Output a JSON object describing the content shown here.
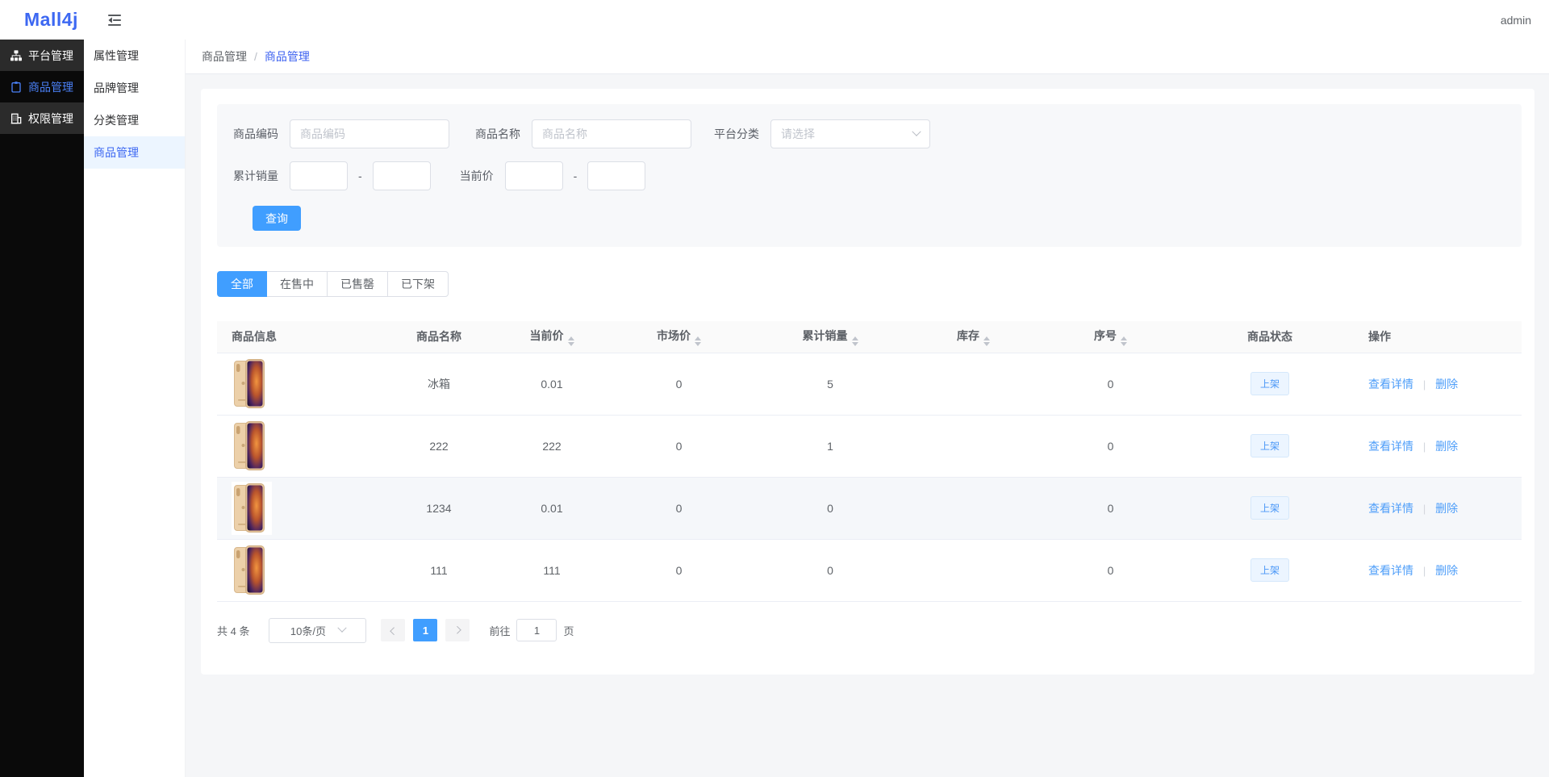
{
  "topbar": {
    "logo": "Mall4j",
    "username": "admin"
  },
  "sidebar": {
    "items": [
      {
        "label": "平台管理",
        "icon": "sitemap-icon",
        "active": false
      },
      {
        "label": "商品管理",
        "icon": "clipboard-icon",
        "active": true
      },
      {
        "label": "权限管理",
        "icon": "building-icon",
        "active": false
      }
    ]
  },
  "submenu": {
    "items": [
      {
        "label": "属性管理",
        "active": false
      },
      {
        "label": "品牌管理",
        "active": false
      },
      {
        "label": "分类管理",
        "active": false
      },
      {
        "label": "商品管理",
        "active": true
      }
    ]
  },
  "breadcrumb": {
    "parent": "商品管理",
    "separator": "/",
    "current": "商品管理"
  },
  "filters": {
    "product_code": {
      "label": "商品编码",
      "placeholder": "商品编码",
      "value": ""
    },
    "product_name": {
      "label": "商品名称",
      "placeholder": "商品名称",
      "value": ""
    },
    "platform_category": {
      "label": "平台分类",
      "placeholder": "请选择"
    },
    "total_sales": {
      "label": "累计销量",
      "min": "",
      "max": ""
    },
    "current_price": {
      "label": "当前价",
      "min": "",
      "max": ""
    },
    "range_separator": "-",
    "search_button": "查询"
  },
  "status_tabs": [
    {
      "label": "全部",
      "active": true
    },
    {
      "label": "在售中",
      "active": false
    },
    {
      "label": "已售罄",
      "active": false
    },
    {
      "label": "已下架",
      "active": false
    }
  ],
  "table": {
    "columns": [
      {
        "label": "商品信息",
        "sortable": false
      },
      {
        "label": "商品名称",
        "sortable": false
      },
      {
        "label": "当前价",
        "sortable": true
      },
      {
        "label": "市场价",
        "sortable": true
      },
      {
        "label": "累计销量",
        "sortable": true
      },
      {
        "label": "库存",
        "sortable": true
      },
      {
        "label": "序号",
        "sortable": true
      },
      {
        "label": "商品状态",
        "sortable": false
      },
      {
        "label": "操作",
        "sortable": false
      }
    ],
    "action_separator": "|",
    "rows": [
      {
        "name": "冰箱",
        "current_price": "0.01",
        "market_price": "0",
        "total_sales": "5",
        "stock": "",
        "seq": "0",
        "status": "上架",
        "view_action": "查看详情",
        "delete_action": "删除",
        "highlighted": false
      },
      {
        "name": "222",
        "current_price": "222",
        "market_price": "0",
        "total_sales": "1",
        "stock": "",
        "seq": "0",
        "status": "上架",
        "view_action": "查看详情",
        "delete_action": "删除",
        "highlighted": false
      },
      {
        "name": "1234",
        "current_price": "0.01",
        "market_price": "0",
        "total_sales": "0",
        "stock": "",
        "seq": "0",
        "status": "上架",
        "view_action": "查看详情",
        "delete_action": "删除",
        "highlighted": true
      },
      {
        "name": "111",
        "current_price": "111",
        "market_price": "0",
        "total_sales": "0",
        "stock": "",
        "seq": "0",
        "status": "上架",
        "view_action": "查看详情",
        "delete_action": "删除",
        "highlighted": false
      }
    ]
  },
  "pagination": {
    "total_text": "共 4 条",
    "page_size": "10条/页",
    "current_page": "1",
    "goto_label": "前往",
    "goto_value": "1",
    "page_unit": "页"
  },
  "colors": {
    "primary": "#409EFF",
    "brand_blue": "#3D62F0",
    "active_submenu_bg": "#ECF5FF",
    "status_badge_bg": "#ECF5FF",
    "sidebar_bg": "#0A0A0A",
    "sidebar_item_bg": "#2B2B2B",
    "highlight_row_bg": "#F5F7FA"
  }
}
